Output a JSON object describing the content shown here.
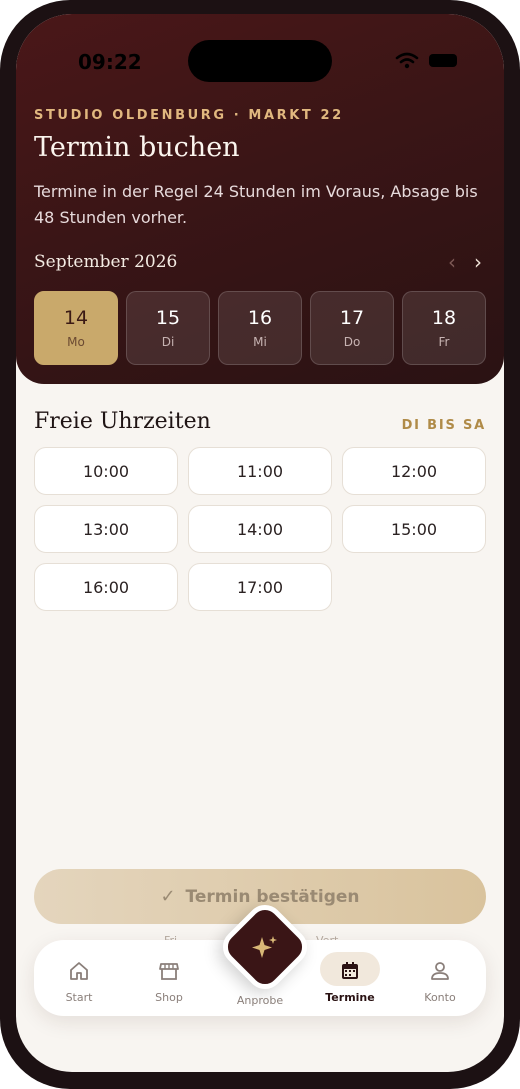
{
  "status": {
    "time": "09:22"
  },
  "header": {
    "eyebrow": "STUDIO OLDENBURG · MARKT 22",
    "title": "Termin buchen",
    "subtitle": "Termine in der Regel 24 Stunden im Voraus, Absage bis 48 Stunden vorher.",
    "month": "September 2026",
    "prev_icon": "chevron-left-icon",
    "next_icon": "chevron-right-icon"
  },
  "days": [
    {
      "num": "14",
      "weekday": "Mo",
      "selected": true
    },
    {
      "num": "15",
      "weekday": "Di",
      "selected": false
    },
    {
      "num": "16",
      "weekday": "Mi",
      "selected": false
    },
    {
      "num": "17",
      "weekday": "Do",
      "selected": false
    },
    {
      "num": "18",
      "weekday": "Fr",
      "selected": false
    }
  ],
  "slots_section": {
    "title": "Freie Uhrzeiten",
    "badge": "DI BIS SA",
    "times": [
      "10:00",
      "11:00",
      "12:00",
      "13:00",
      "14:00",
      "15:00",
      "16:00",
      "17:00"
    ]
  },
  "confirm": {
    "label": "Termin bestätigen",
    "icon": "check-icon"
  },
  "hints": {
    "left": "Fri",
    "right": "Vert"
  },
  "tabs": [
    {
      "label": "Start",
      "icon": "home-icon",
      "active": false
    },
    {
      "label": "Shop",
      "icon": "shop-icon",
      "active": false
    },
    {
      "label": "Anprobe",
      "icon": "sparkle-icon",
      "active": false
    },
    {
      "label": "Termine",
      "icon": "calendar-icon",
      "active": true
    },
    {
      "label": "Konto",
      "icon": "person-icon",
      "active": false
    }
  ],
  "colors": {
    "hero": "#3a1516",
    "accent": "#c9a96b",
    "gold_text": "#e1b87f",
    "background": "#f8f5f1"
  }
}
